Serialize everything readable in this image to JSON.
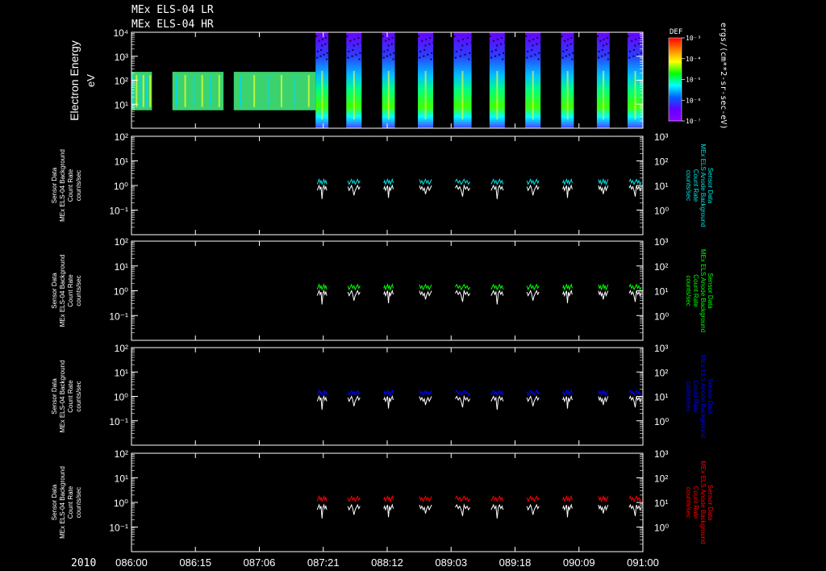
{
  "title_lines": [
    "MEx ELS-04 LR",
    "MEx ELS-04 HR"
  ],
  "colorbar": {
    "label": "DEF",
    "unit": "ergs/(cm**2-sr-sec-eV)",
    "ticks": [
      "10⁻³",
      "10⁻⁴",
      "10⁻⁵",
      "10⁻⁶",
      "10⁻⁷"
    ],
    "colors": [
      "#ff0000",
      "#ff8000",
      "#ffff00",
      "#00ff00",
      "#00ffff",
      "#0060ff",
      "#6000ff",
      "#9000ff"
    ]
  },
  "x_axis": {
    "year": "2010",
    "tick_labels": [
      "086:00",
      "086:15",
      "087:06",
      "087:21",
      "088:12",
      "089:03",
      "089:18",
      "090:09",
      "091:00"
    ]
  },
  "chart_data": [
    {
      "type": "heatmap",
      "ylabel": "Electron Energy",
      "yunit": "eV",
      "yscale": "log",
      "ylim_exp": [
        0,
        4
      ],
      "y_ticks": [
        "10⁴",
        "10³",
        "10²",
        "10¹"
      ],
      "segments_lr": [
        [
          0.0,
          0.04
        ],
        [
          0.08,
          0.18
        ],
        [
          0.2,
          0.36
        ]
      ],
      "segments_hr": [
        [
          0.36,
          0.385
        ],
        [
          0.42,
          0.45
        ],
        [
          0.49,
          0.515
        ],
        [
          0.56,
          0.59
        ],
        [
          0.63,
          0.665
        ],
        [
          0.7,
          0.73
        ],
        [
          0.77,
          0.8
        ],
        [
          0.84,
          0.865
        ],
        [
          0.91,
          0.935
        ],
        [
          0.97,
          1.0
        ]
      ]
    },
    {
      "type": "line",
      "ylabel_lines": [
        "Sensor Data",
        "MEx ELS-04 Background",
        "Count Rate",
        "counts/sec"
      ],
      "right_label_lines": [
        "Sensor Data",
        "MEx ELS Anode Background",
        "Count Rate",
        "counts/sec"
      ],
      "accent": "#00e5e5",
      "yscale": "log",
      "y_ticks_left": [
        "10²",
        "10¹",
        "10⁰",
        "10⁻¹"
      ],
      "y_ticks_right": [
        "10³",
        "10²",
        "10¹",
        "10⁰"
      ],
      "series": [
        {
          "color": "#ffffff",
          "level_log10": -0.1
        },
        {
          "color": "#00e5e5",
          "level_log10": 0.15
        }
      ]
    },
    {
      "type": "line",
      "ylabel_lines": [
        "Sensor Data",
        "MEx ELS-04 Background",
        "Count Rate",
        "counts/sec"
      ],
      "right_label_lines": [
        "Sensor Data",
        "MEx ELS Anode Background",
        "Count Rate",
        "counts/sec"
      ],
      "accent": "#00ff00",
      "yscale": "log",
      "y_ticks_left": [
        "10²",
        "10¹",
        "10⁰",
        "10⁻¹"
      ],
      "y_ticks_right": [
        "10³",
        "10²",
        "10¹",
        "10⁰"
      ],
      "series": [
        {
          "color": "#ffffff",
          "level_log10": -0.1
        },
        {
          "color": "#00ff00",
          "level_log10": 0.15
        }
      ]
    },
    {
      "type": "line",
      "ylabel_lines": [
        "Sensor Data",
        "MEx ELS-04 Background",
        "Count Rate",
        "counts/sec"
      ],
      "right_label_lines": [
        "Sensor Data",
        "MEx ELS Anode Background",
        "Count Rate",
        "counts/sec"
      ],
      "accent": "#0000ff",
      "yscale": "log",
      "y_ticks_left": [
        "10²",
        "10¹",
        "10⁰",
        "10⁻¹"
      ],
      "y_ticks_right": [
        "10³",
        "10²",
        "10¹",
        "10⁰"
      ],
      "series": [
        {
          "color": "#ffffff",
          "level_log10": -0.1
        },
        {
          "color": "#0000ff",
          "level_log10": 0.15
        }
      ]
    },
    {
      "type": "line",
      "ylabel_lines": [
        "Sensor Data",
        "MEx ELS-04 Background",
        "Count Rate",
        "counts/sec"
      ],
      "right_label_lines": [
        "Sensor Data",
        "MEx ELS Anode Background",
        "Count Rate",
        "counts/sec"
      ],
      "accent": "#ff0000",
      "yscale": "log",
      "y_ticks_left": [
        "10²",
        "10¹",
        "10⁰",
        "10⁻¹"
      ],
      "y_ticks_right": [
        "10³",
        "10²",
        "10¹",
        "10⁰"
      ],
      "series": [
        {
          "color": "#ffffff",
          "level_log10": -0.2
        },
        {
          "color": "#ff0000",
          "level_log10": 0.15
        }
      ]
    }
  ]
}
